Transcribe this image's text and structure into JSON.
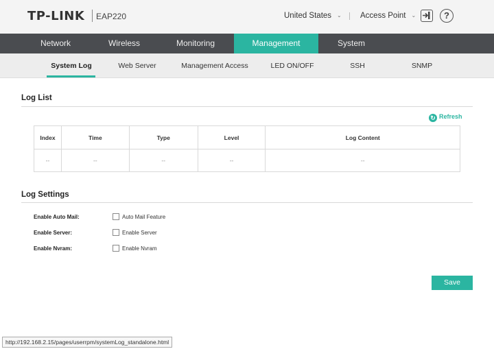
{
  "header": {
    "brand": "TP-LINK",
    "model": "EAP220",
    "region": "United States",
    "mode": "Access Point"
  },
  "main_nav": [
    {
      "label": "Network"
    },
    {
      "label": "Wireless"
    },
    {
      "label": "Monitoring"
    },
    {
      "label": "Management",
      "active": true
    },
    {
      "label": "System"
    }
  ],
  "sub_nav": [
    {
      "label": "System Log",
      "active": true
    },
    {
      "label": "Web Server"
    },
    {
      "label": "Management Access"
    },
    {
      "label": "LED ON/OFF"
    },
    {
      "label": "SSH"
    },
    {
      "label": "SNMP"
    }
  ],
  "log_list": {
    "title": "Log List",
    "refresh_label": "Refresh",
    "columns": [
      "Index",
      "Time",
      "Type",
      "Level",
      "Log Content"
    ],
    "rows": [
      [
        "--",
        "--",
        "--",
        "--",
        "--"
      ]
    ]
  },
  "log_settings": {
    "title": "Log Settings",
    "items": [
      {
        "label": "Enable Auto Mail:",
        "checkbox_label": "Auto Mail Feature",
        "checked": false
      },
      {
        "label": "Enable Server:",
        "checkbox_label": "Enable Server",
        "checked": false
      },
      {
        "label": "Enable Nvram:",
        "checkbox_label": "Enable Nvram",
        "checked": false
      }
    ]
  },
  "save_label": "Save",
  "status_url": "http://192.168.2.15/pages/userrpm/systemLog_standalone.html",
  "colors": {
    "accent": "#2bb5a1",
    "nav_bg": "#4a4c50"
  }
}
